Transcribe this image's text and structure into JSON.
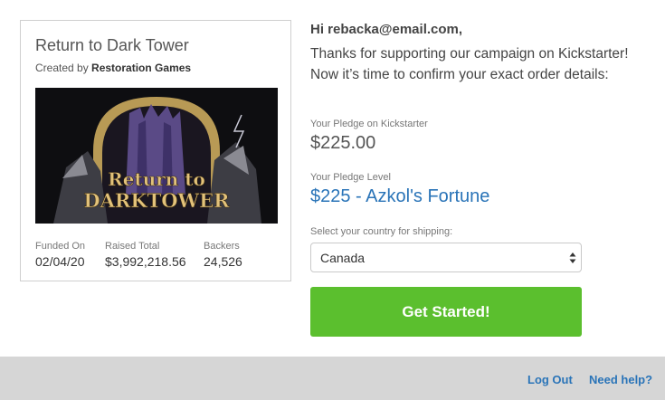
{
  "project": {
    "title": "Return to Dark Tower",
    "created_by_label": "Created by",
    "creator": "Restoration Games",
    "image_alt": "Return to Dark Tower",
    "image_text_line1": "Return to",
    "image_text_line2": "DARKTOWER",
    "stats": [
      {
        "label": "Funded On",
        "value": "02/04/20"
      },
      {
        "label": "Raised Total",
        "value": "$3,992,218.56"
      },
      {
        "label": "Backers",
        "value": "24,526"
      }
    ]
  },
  "message": {
    "greeting": "Hi rebacka@email.com,",
    "intro": "Thanks for supporting our campaign on Kickstarter! Now it’s time to confirm your exact order details:"
  },
  "pledge": {
    "amount_label": "Your Pledge on Kickstarter",
    "amount": "$225.00",
    "level_label": "Your Pledge Level",
    "level": "$225 - Azkol's Fortune"
  },
  "shipping": {
    "label": "Select your country for shipping:",
    "selected": "Canada"
  },
  "cta_label": "Get Started!",
  "footer": {
    "logout": "Log Out",
    "help": "Need help?"
  },
  "colors": {
    "accent_link": "#2a74b8",
    "cta_green": "#5bbf2e",
    "footer_bg": "#d6d6d6"
  },
  "icons": {
    "select_arrows": "updown-arrows-icon"
  }
}
